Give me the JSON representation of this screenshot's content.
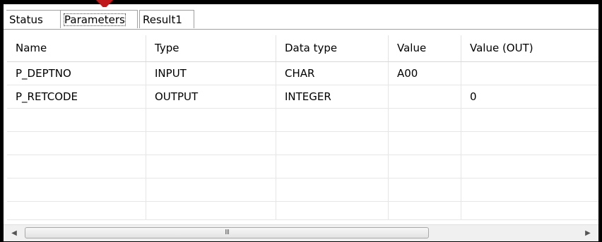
{
  "tabs": [
    {
      "label": "Status"
    },
    {
      "label": "Parameters"
    },
    {
      "label": "Result1"
    }
  ],
  "active_tab": "Parameters",
  "table": {
    "columns": [
      "Name",
      "Type",
      "Data type",
      "Value",
      "Value (OUT)"
    ],
    "rows": [
      [
        "P_DEPTNO",
        "INPUT",
        "CHAR",
        "A00",
        ""
      ],
      [
        "P_RETCODE",
        "OUTPUT",
        "INTEGER",
        "",
        "0"
      ]
    ]
  },
  "scrollbar": {
    "left_arrow_icon": "chevron-left-icon",
    "right_arrow_icon": "chevron-right-icon",
    "grip": "III"
  },
  "colors": {
    "frame": "#000000",
    "arrow": "#c0171a",
    "scrollbar_bg": "#f0f0f0"
  }
}
